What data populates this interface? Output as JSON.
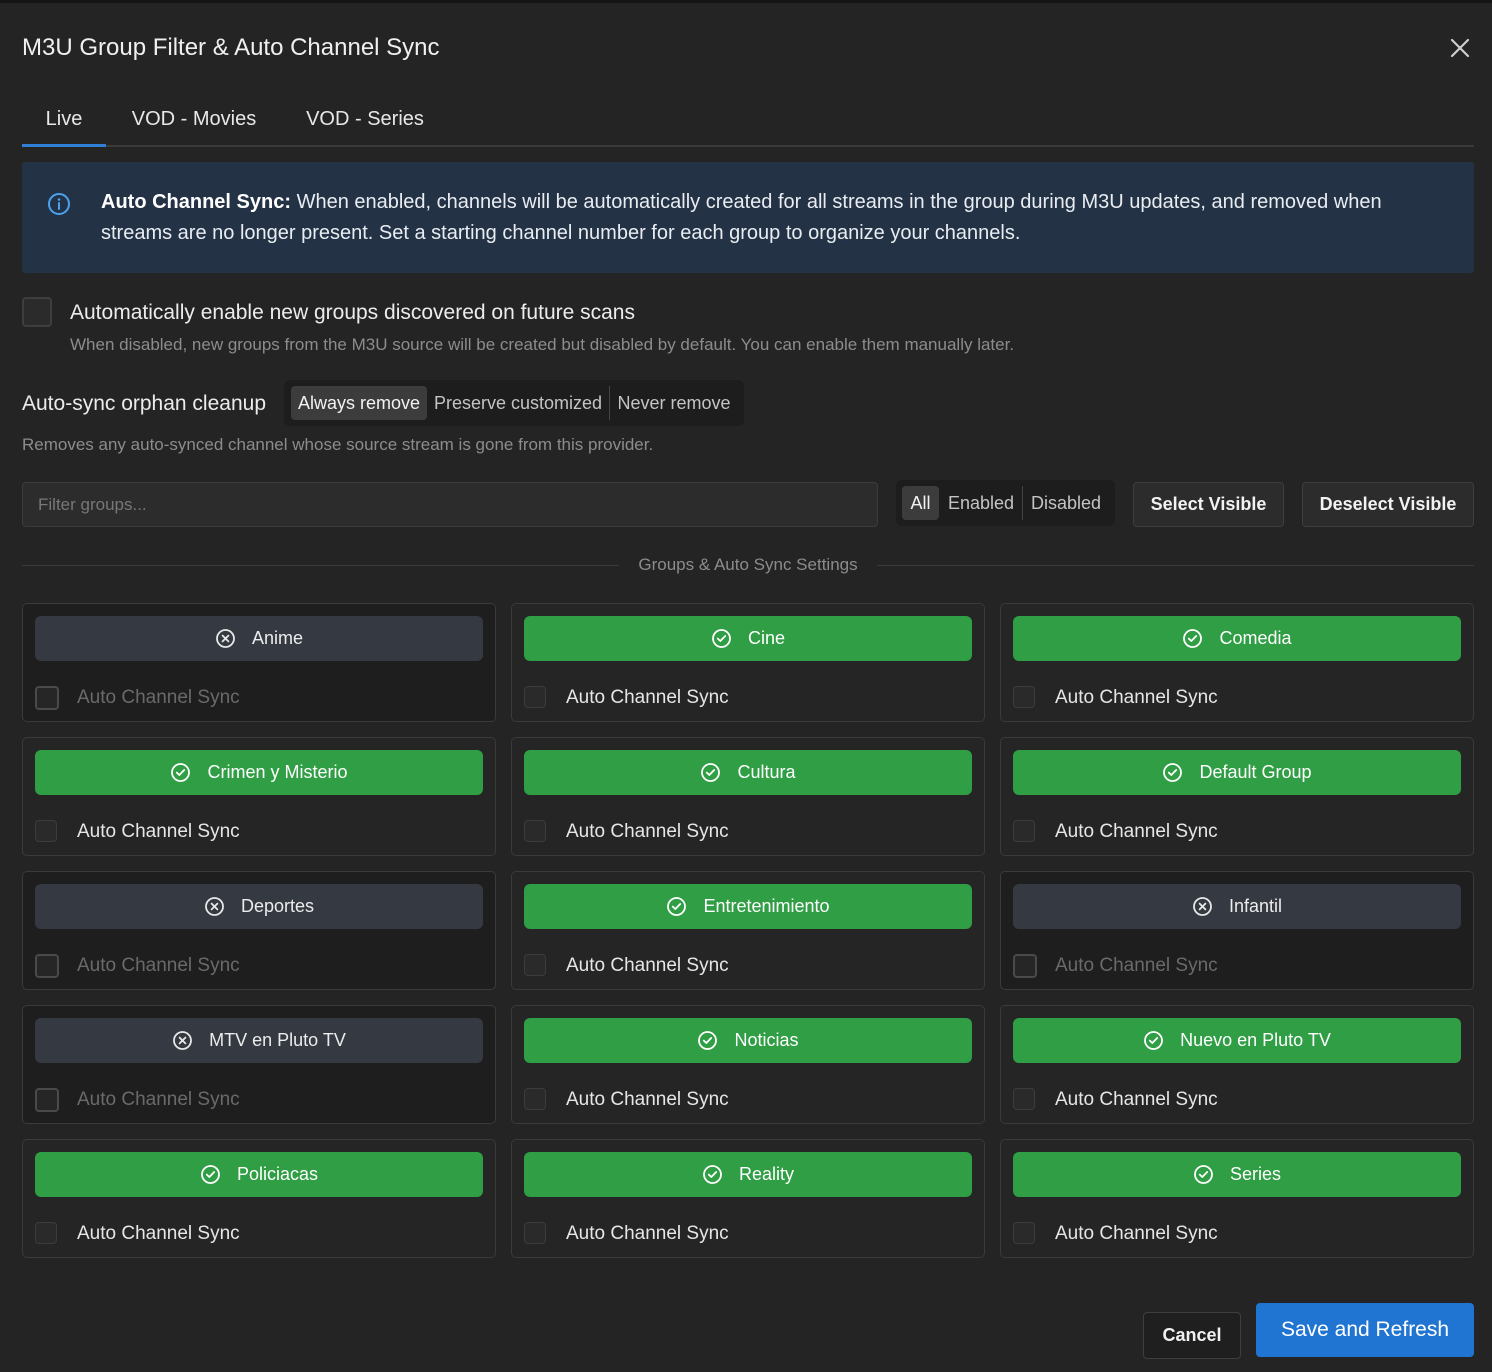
{
  "dialog": {
    "title": "M3U Group Filter & Auto Channel Sync",
    "close_icon": "close-icon"
  },
  "tabs": [
    {
      "label": "Live",
      "active": true
    },
    {
      "label": "VOD - Movies",
      "active": false
    },
    {
      "label": "VOD - Series",
      "active": false
    }
  ],
  "info": {
    "icon": "info-icon",
    "bold": "Auto Channel Sync:",
    "text": " When enabled, channels will be automatically created for all streams in the group during M3U updates, and removed when streams are no longer present. Set a starting channel number for each group to organize your channels."
  },
  "auto_enable": {
    "checked": false,
    "label": "Automatically enable new groups discovered on future scans",
    "description": "When disabled, new groups from the M3U source will be created but disabled by default. You can enable them manually later."
  },
  "orphan": {
    "label": "Auto-sync orphan cleanup",
    "options": [
      "Always remove",
      "Preserve customized",
      "Never remove"
    ],
    "selected": "Always remove",
    "description": "Removes any auto-synced channel whose source stream is gone from this provider."
  },
  "filter": {
    "placeholder": "Filter groups...",
    "value": "",
    "options": [
      "All",
      "Enabled",
      "Disabled"
    ],
    "selected": "All",
    "select_visible": "Select Visible",
    "deselect_visible": "Deselect Visible"
  },
  "groups_header": "Groups & Auto Sync Settings",
  "groups": [
    {
      "name": "Anime",
      "enabled": false,
      "sync_label": "Auto Channel Sync",
      "sync": false
    },
    {
      "name": "Cine",
      "enabled": true,
      "sync_label": "Auto Channel Sync",
      "sync": false
    },
    {
      "name": "Comedia",
      "enabled": true,
      "sync_label": "Auto Channel Sync",
      "sync": false
    },
    {
      "name": "Crimen y Misterio",
      "enabled": true,
      "sync_label": "Auto Channel Sync",
      "sync": false
    },
    {
      "name": "Cultura",
      "enabled": true,
      "sync_label": "Auto Channel Sync",
      "sync": false
    },
    {
      "name": "Default Group",
      "enabled": true,
      "sync_label": "Auto Channel Sync",
      "sync": false
    },
    {
      "name": "Deportes",
      "enabled": false,
      "sync_label": "Auto Channel Sync",
      "sync": false
    },
    {
      "name": "Entretenimiento",
      "enabled": true,
      "sync_label": "Auto Channel Sync",
      "sync": false
    },
    {
      "name": "Infantil",
      "enabled": false,
      "sync_label": "Auto Channel Sync",
      "sync": false
    },
    {
      "name": "MTV en Pluto TV",
      "enabled": false,
      "sync_label": "Auto Channel Sync",
      "sync": false
    },
    {
      "name": "Noticias",
      "enabled": true,
      "sync_label": "Auto Channel Sync",
      "sync": false
    },
    {
      "name": "Nuevo en Pluto TV",
      "enabled": true,
      "sync_label": "Auto Channel Sync",
      "sync": false
    },
    {
      "name": "Policiacas",
      "enabled": true,
      "sync_label": "Auto Channel Sync",
      "sync": false
    },
    {
      "name": "Reality",
      "enabled": true,
      "sync_label": "Auto Channel Sync",
      "sync": false
    },
    {
      "name": "Series",
      "enabled": true,
      "sync_label": "Auto Channel Sync",
      "sync": false
    }
  ],
  "footer": {
    "cancel": "Cancel",
    "save": "Save and Refresh"
  },
  "colors": {
    "enabled": "#2f9e44",
    "disabled": "#353a42",
    "accent": "#2175d2",
    "info_bg": "#233245"
  }
}
